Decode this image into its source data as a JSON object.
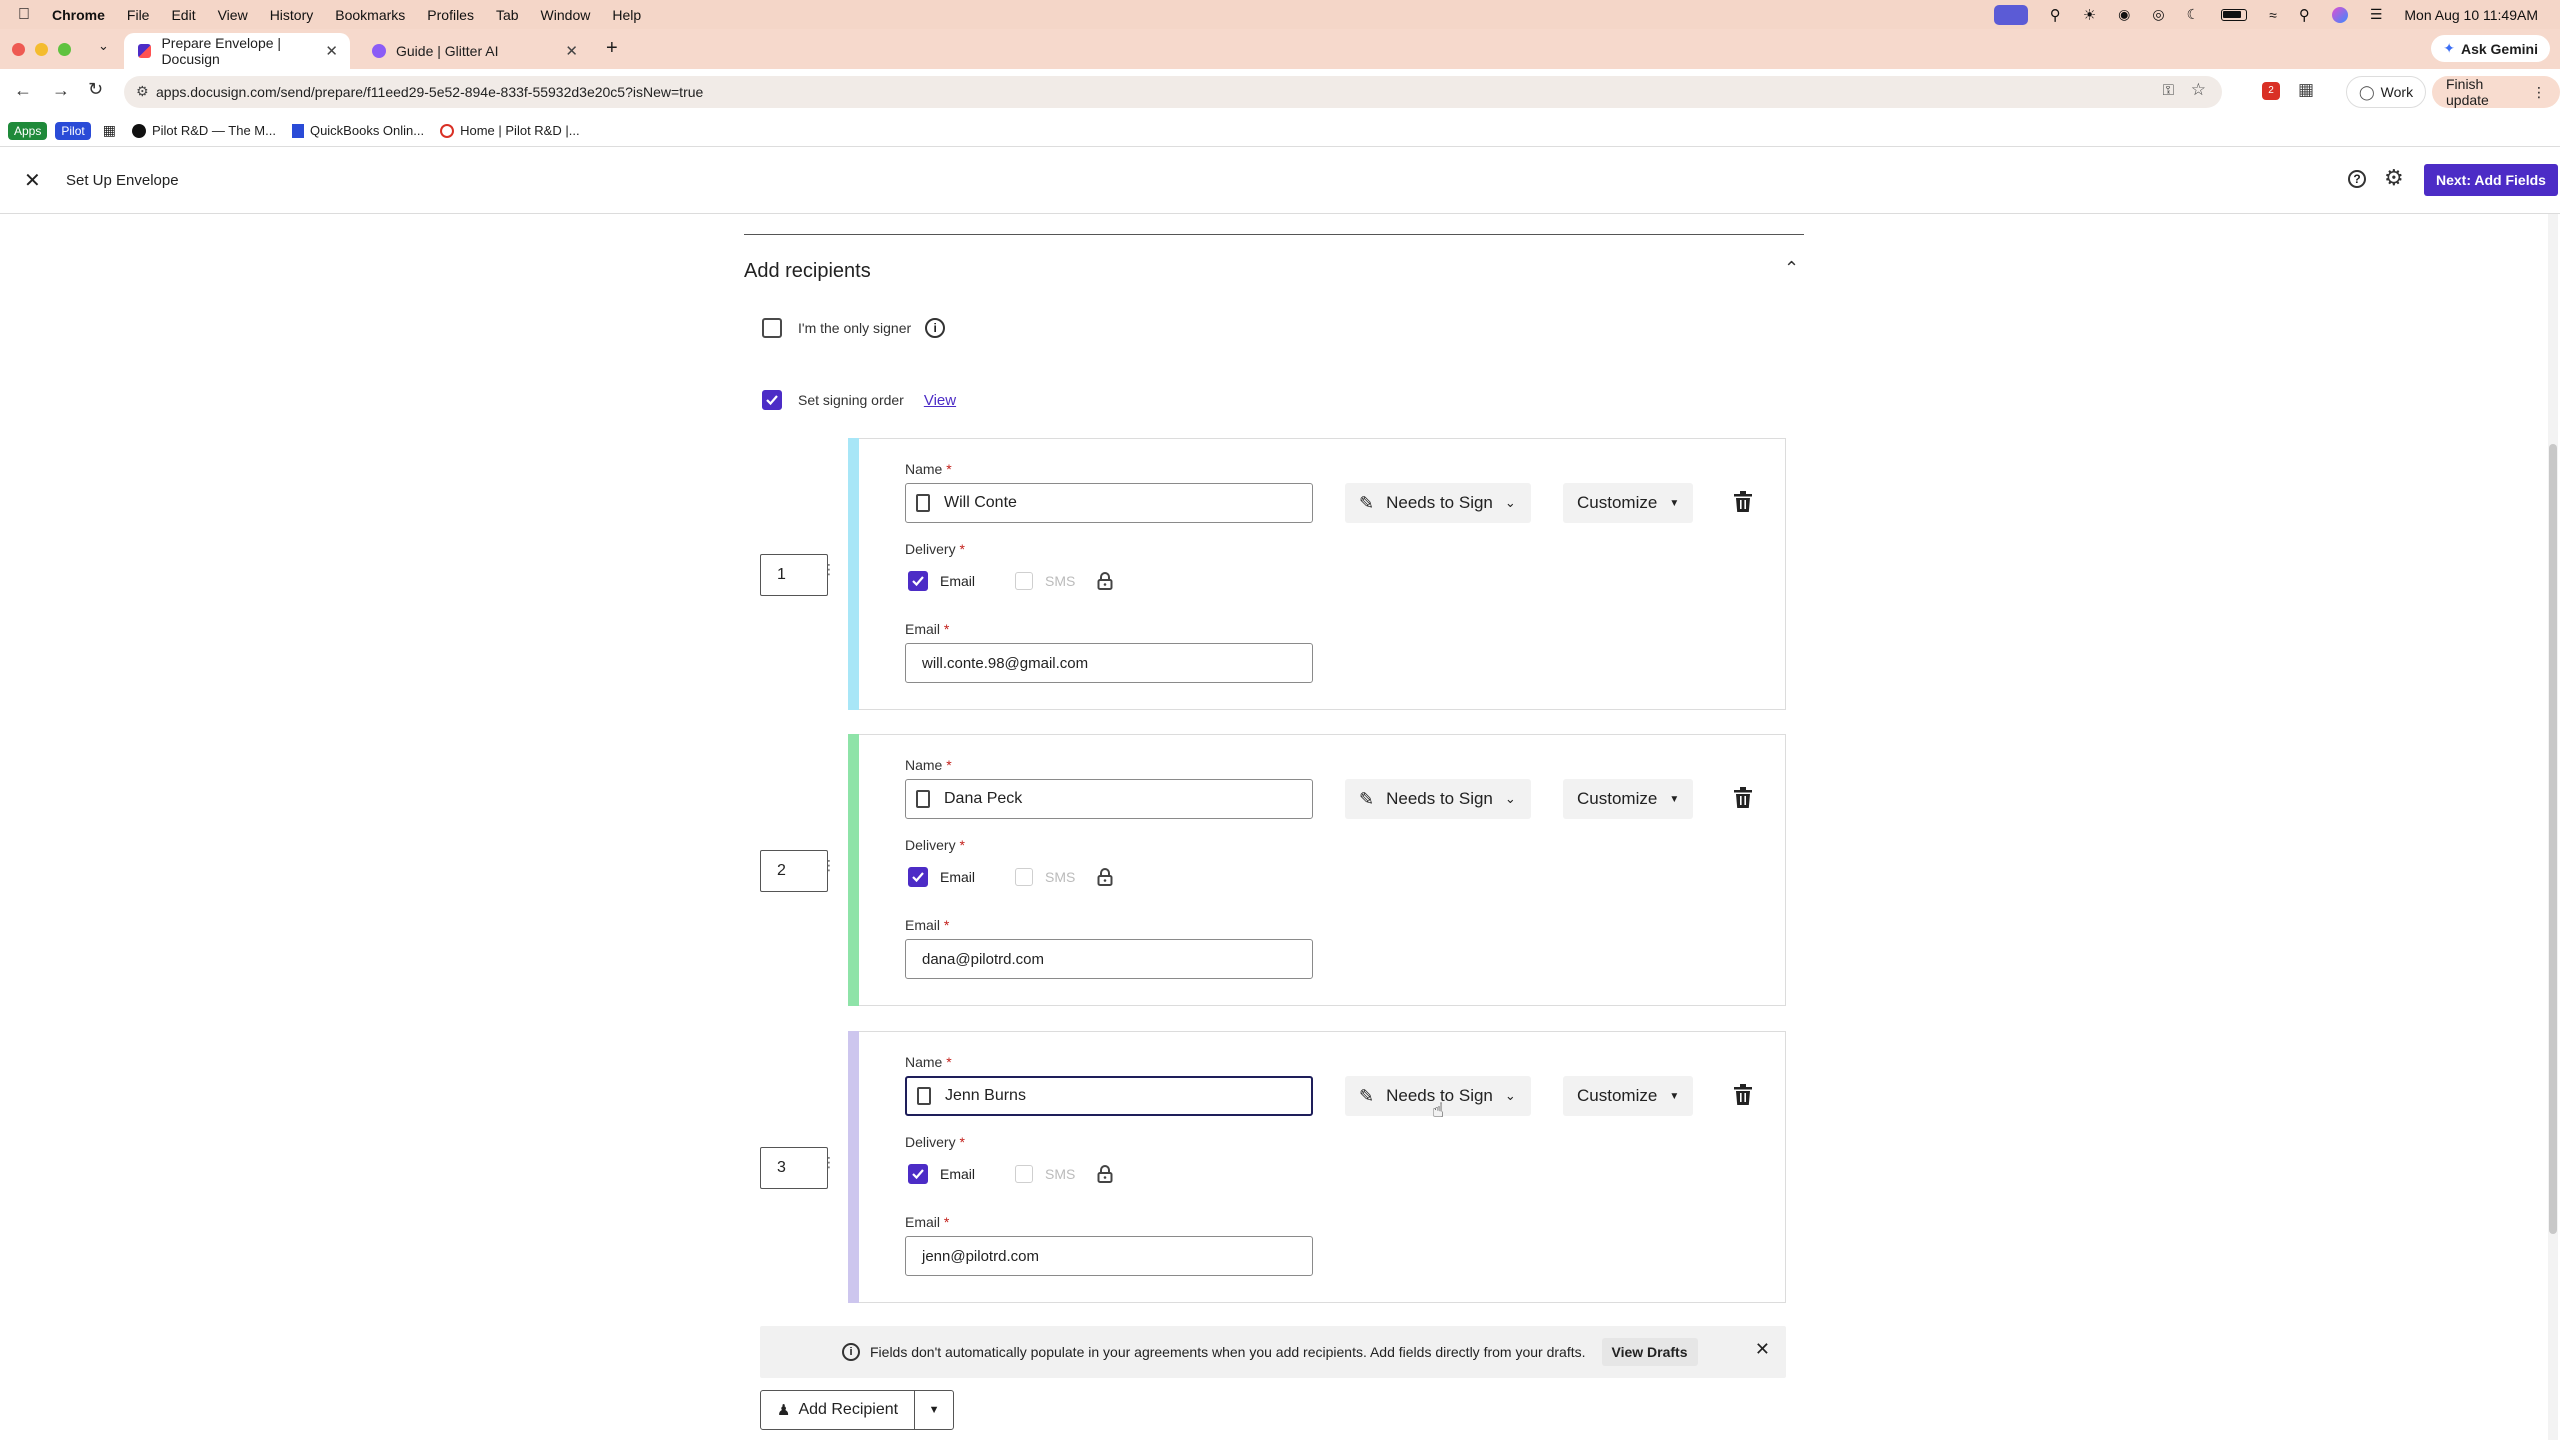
{
  "menubar": {
    "app": "Chrome",
    "items": [
      "File",
      "Edit",
      "View",
      "History",
      "Bookmarks",
      "Profiles",
      "Tab",
      "Window",
      "Help"
    ],
    "datetime": "Mon Aug 10  11:49AM",
    "ask_gemini": "Ask Gemini"
  },
  "tabs": [
    {
      "title": "Prepare Envelope | Docusign",
      "active": true
    },
    {
      "title": "Guide | Glitter AI",
      "active": false
    }
  ],
  "toolbar": {
    "url": "apps.docusign.com/send/prepare/f11eed29-5e52-894e-833f-55932d3e20c5?isNew=true",
    "profile": "Work",
    "finish_update": "Finish update",
    "ext_badge": "2"
  },
  "bookmarks": [
    {
      "label": "Apps"
    },
    {
      "label": "Pilot"
    },
    {
      "label": "Pilot R&D — The M..."
    },
    {
      "label": "QuickBooks Onlin..."
    },
    {
      "label": "Home | Pilot R&D |..."
    }
  ],
  "header": {
    "title": "Set Up Envelope",
    "next_button": "Next: Add Fields"
  },
  "section": {
    "title": "Add recipients",
    "only_signer_label": "I'm the only signer",
    "only_signer_checked": false,
    "signing_order_label": "Set signing order",
    "signing_order_checked": true,
    "view_link": "View"
  },
  "field_labels": {
    "name": "Name",
    "delivery": "Delivery",
    "email": "Email",
    "required": "*",
    "email_option": "Email",
    "sms_option": "SMS"
  },
  "recipients": [
    {
      "order": "1",
      "name": "Will Conte",
      "email": "will.conte.98@gmail.com",
      "action": "Needs to Sign",
      "customize": "Customize",
      "stripe_color": "#a8e6f7",
      "email_checked": true,
      "sms_checked": false
    },
    {
      "order": "2",
      "name": "Dana Peck",
      "email": "dana@pilotrd.com",
      "action": "Needs to Sign",
      "customize": "Customize",
      "stripe_color": "#8ee3a8",
      "email_checked": true,
      "sms_checked": false
    },
    {
      "order": "3",
      "name": "Jenn Burns",
      "email": "jenn@pilotrd.com",
      "action": "Needs to Sign",
      "customize": "Customize",
      "stripe_color": "#cdc6ee",
      "email_checked": true,
      "sms_checked": false
    }
  ],
  "info_banner": {
    "text": "Fields don't automatically populate in your agreements when you add recipients. Add fields directly from your drafts.",
    "link": "View Drafts"
  },
  "add_recipient": {
    "label": "Add Recipient"
  },
  "colors": {
    "accent": "#4c2cc6",
    "chrome_tab_bg": "#f6d9cc"
  }
}
